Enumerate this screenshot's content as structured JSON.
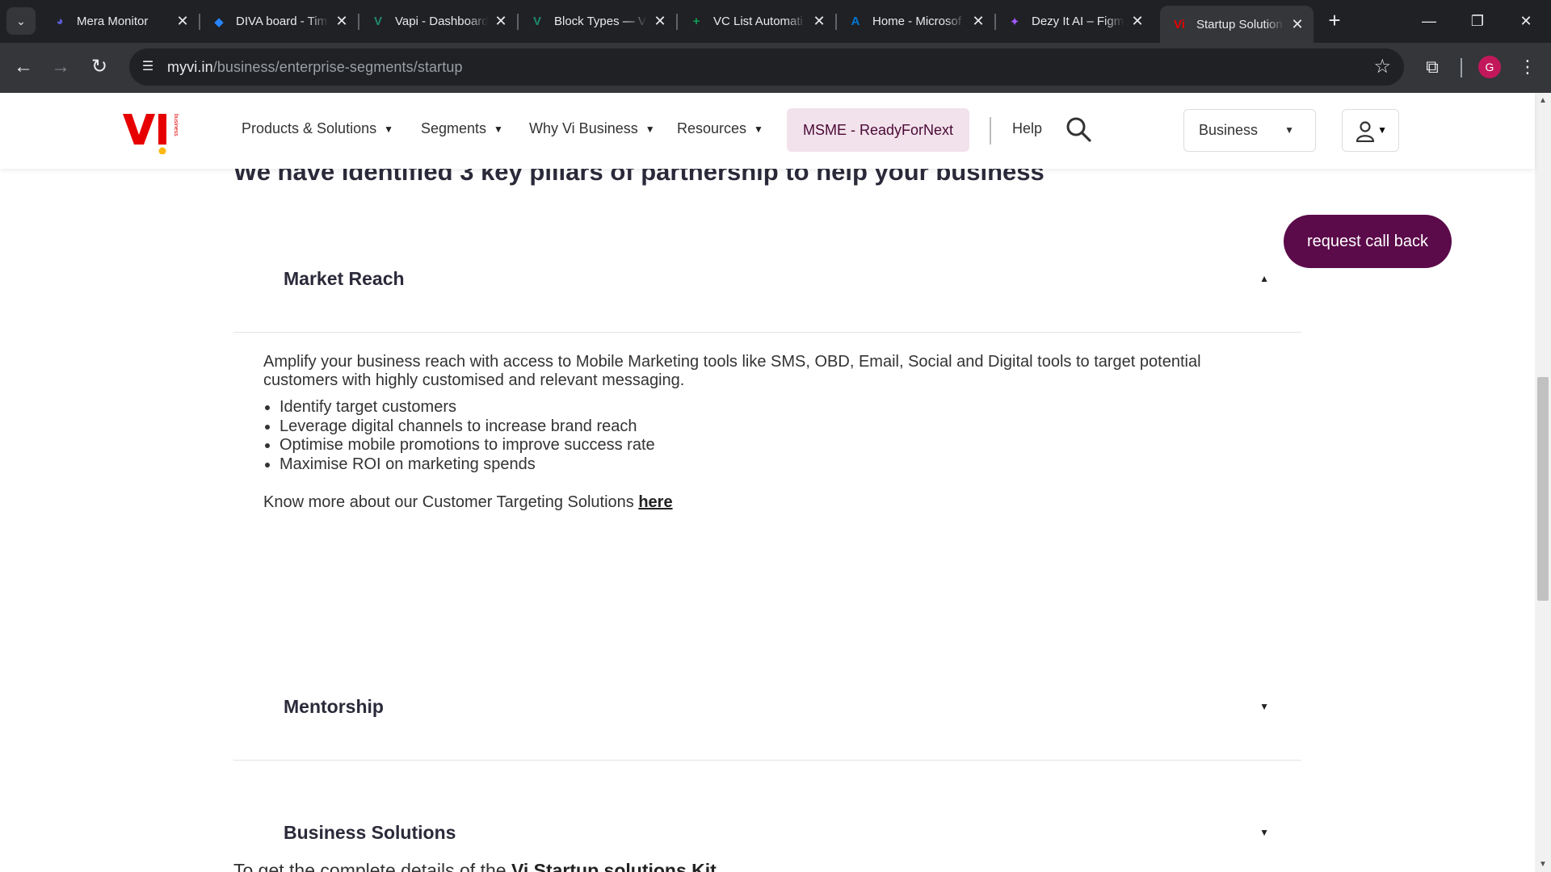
{
  "browser": {
    "tabs": [
      {
        "title": "Mera Monitor",
        "icon": "mera-monitor-icon",
        "color": "#5b5bd6",
        "glyph": "◕"
      },
      {
        "title": "DIVA board - Tim",
        "icon": "jira-icon",
        "color": "#2684ff",
        "glyph": "◆"
      },
      {
        "title": "Vapi - Dashboard",
        "icon": "vapi-icon",
        "color": "#1f8a70",
        "glyph": "V"
      },
      {
        "title": "Block Types — V",
        "icon": "vapi-icon",
        "color": "#1f8a70",
        "glyph": "V"
      },
      {
        "title": "VC List Automati",
        "icon": "google-sheets-icon",
        "color": "#0f9d58",
        "glyph": "+"
      },
      {
        "title": "Home - Microsof",
        "icon": "azure-icon",
        "color": "#0078d4",
        "glyph": "A"
      },
      {
        "title": "Dezy It AI – Figm",
        "icon": "figma-icon",
        "color": "#a259ff",
        "glyph": "✦"
      },
      {
        "title": "Startup Solution",
        "icon": "vi-icon",
        "color": "#e60000",
        "glyph": "Vi"
      }
    ],
    "active_tab_index": 7,
    "url_host": "myvi.in",
    "url_path": "/business/enterprise-segments/startup",
    "profile_initial": "G"
  },
  "header": {
    "nav": [
      {
        "label": "Products & Solutions"
      },
      {
        "label": "Segments"
      },
      {
        "label": "Why Vi Business"
      },
      {
        "label": "Resources"
      }
    ],
    "msme_label": "MSME - ReadyForNext",
    "help_label": "Help",
    "business_select": "Business"
  },
  "main": {
    "heading": "We have identified 3 key pillars of partnership to help your business",
    "callback_label": "request call back",
    "accordion": [
      {
        "title": "Market Reach",
        "expanded": true,
        "description": "Amplify your business reach with access to Mobile Marketing tools like SMS, OBD, Email, Social and Digital tools to target potential customers with highly customised and relevant messaging.",
        "bullets": [
          "Identify target customers",
          "Leverage digital channels to increase brand reach",
          "Optimise mobile promotions to improve success rate",
          "Maximise ROI on marketing spends"
        ],
        "more_text": "Know more about our Customer Targeting Solutions ",
        "more_link": "here"
      },
      {
        "title": "Mentorship",
        "expanded": false
      },
      {
        "title": "Business Solutions",
        "expanded": false
      }
    ],
    "partial_text": "To get the complete details of the ",
    "partial_bold": "Vi Startup solutions Kit"
  },
  "colors": {
    "brand_red": "#e60000",
    "brand_yellow": "#fdb913",
    "brand_purple": "#5b0a4a",
    "msme_bg": "#f2e2ec"
  }
}
